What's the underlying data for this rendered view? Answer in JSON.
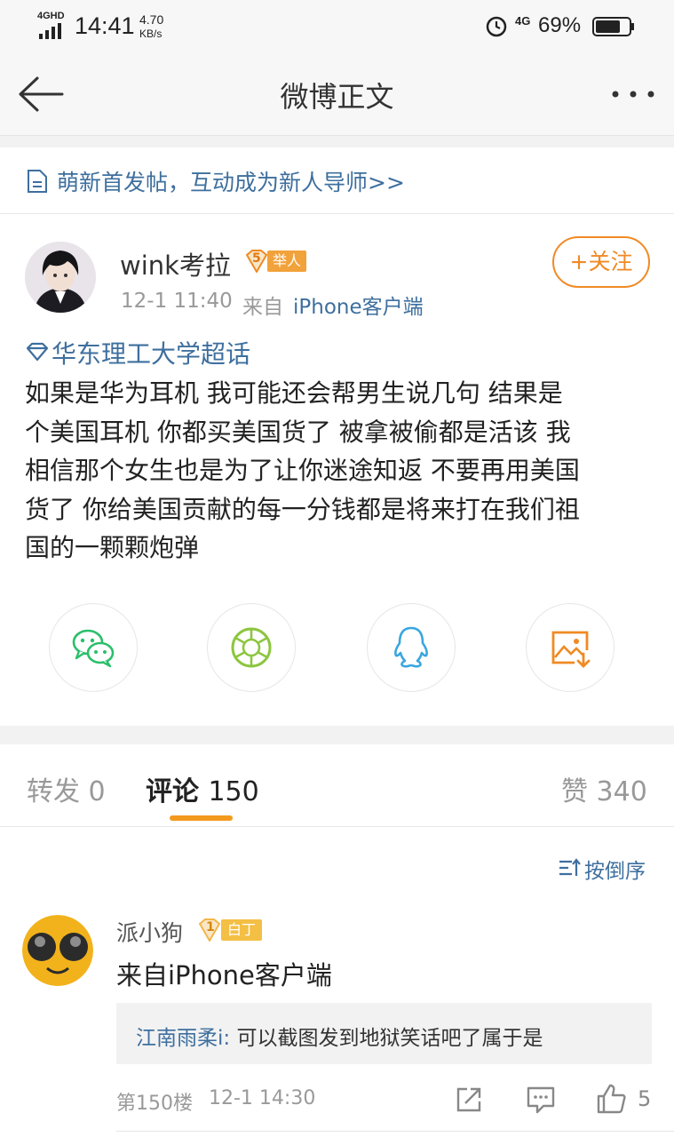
{
  "status_bar": {
    "network": "4GHD",
    "time": "14:41",
    "speed_value": "4.70",
    "speed_unit": "KB/s",
    "net_right": "4G",
    "battery": "69%"
  },
  "nav": {
    "title": "微博正文"
  },
  "notice": {
    "text": "萌新首发帖，互动成为新人导师>>"
  },
  "post": {
    "author": "wink考拉",
    "level": "5",
    "badge": "举人",
    "follow_label": "+关注",
    "time": "12-1 11:40",
    "source_prefix": "来自",
    "source": "iPhone客户端",
    "topic": "华东理工大学超话",
    "lines": [
      "如果是华为耳机 我可能还会帮男生说几句 结果是",
      "个美国耳机 你都买美国货了 被拿被偷都是活该 我",
      "相信那个女生也是为了让你迷途知返 不要再用美国",
      "货了 你给美国贡献的每一分钱都是将来打在我们祖",
      "国的一颗颗炮弹"
    ]
  },
  "share_icons": [
    "wechat-icon",
    "moments-icon",
    "qq-icon",
    "save-image-icon"
  ],
  "tabs": {
    "repost_label": "转发",
    "repost_count": "0",
    "comment_label": "评论",
    "comment_count": "150",
    "like_label": "赞",
    "like_count": "340"
  },
  "sort_label": "按倒序",
  "comment": {
    "author": "派小狗",
    "level": "1",
    "badge": "白丁",
    "text": "来自iPhone客户端",
    "reply_author": "江南雨柔i",
    "reply_sep": ":",
    "reply_text": "可以截图发到地狱笑话吧了属于是",
    "floor": "第150楼",
    "time": "12-1 14:30",
    "likes": "5"
  },
  "colors": {
    "accent_orange": "#f08a24",
    "link_blue": "#3e6f9e",
    "tab_underline": "#f39a1e",
    "wechat_green": "#2bbf6a",
    "moments_green": "#8cc63f",
    "qq_blue": "#3aa6e0"
  }
}
